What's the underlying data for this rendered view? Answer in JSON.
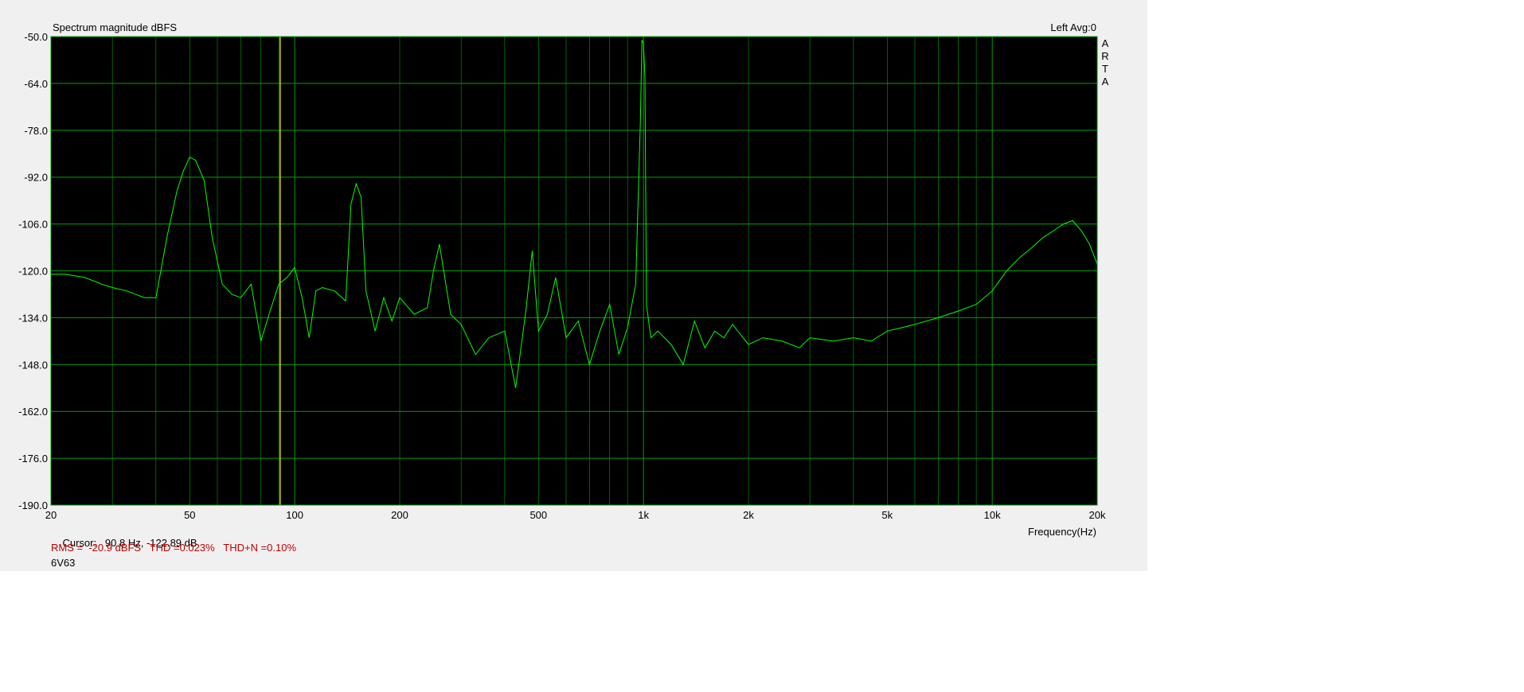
{
  "window": {
    "title_left": "Spectrum magnitude dBFS",
    "title_right": "Left  Avg:0",
    "brand_letters": [
      "A",
      "R",
      "T",
      "A"
    ]
  },
  "cursor": {
    "label": "Cursor:",
    "value": "90.8 Hz, -122.89 dB",
    "frequency_hz": 90.8
  },
  "stats": {
    "text": "RMS =  -20.9 dBFS   THD =0.023%   THD+N =0.10%"
  },
  "device_label": "6V63",
  "colors": {
    "plot_background": "#000000",
    "grid": "#00a000",
    "trace": "#00ff00",
    "cursor_line": "#d2d200",
    "stats_text": "#c00000",
    "panel_background": "#f0f0f0"
  },
  "chart_data": {
    "type": "line",
    "title": "Spectrum magnitude dBFS",
    "xlabel": "Frequency(Hz)",
    "ylabel": "",
    "xscale": "log",
    "xlim": [
      20,
      20000
    ],
    "ylim": [
      -190,
      -50
    ],
    "yticks": [
      -50,
      -64,
      -78,
      -92,
      -106,
      -120,
      -134,
      -148,
      -162,
      -176,
      -190
    ],
    "ytick_labels": [
      "-50.0",
      "-64.0",
      "-78.0",
      "-92.0",
      "-106.0",
      "-120.0",
      "-134.0",
      "-148.0",
      "-162.0",
      "-176.0",
      "-190.0"
    ],
    "xticks": [
      20,
      50,
      100,
      200,
      500,
      1000,
      2000,
      5000,
      10000,
      20000
    ],
    "xtick_labels": [
      "20",
      "50",
      "100",
      "200",
      "500",
      "1k",
      "2k",
      "5k",
      "10k",
      "20k"
    ],
    "grid": true,
    "series": [
      {
        "x": [
          20,
          22,
          25,
          28,
          30,
          33,
          37,
          40,
          43,
          46,
          48,
          50,
          52,
          55,
          58,
          62,
          66,
          70,
          75,
          80,
          85,
          90,
          95,
          100,
          105,
          110,
          115,
          120,
          130,
          140,
          145,
          150,
          155,
          160,
          170,
          180,
          190,
          200,
          220,
          240,
          250,
          260,
          280,
          300,
          330,
          360,
          400,
          430,
          460,
          480,
          500,
          530,
          560,
          600,
          650,
          700,
          750,
          800,
          850,
          900,
          950,
          980,
          990,
          1000,
          1010,
          1020,
          1050,
          1100,
          1200,
          1300,
          1400,
          1500,
          1600,
          1700,
          1800,
          2000,
          2200,
          2500,
          2800,
          3000,
          3500,
          4000,
          4500,
          5000,
          5500,
          6000,
          7000,
          8000,
          9000,
          10000,
          11000,
          12000,
          13000,
          14000,
          15000,
          16000,
          17000,
          18000,
          19000,
          20000
        ],
        "y": [
          -121,
          -121,
          -122,
          -124,
          -125,
          -126,
          -128,
          -128,
          -110,
          -96,
          -90,
          -86,
          -87,
          -93,
          -110,
          -124,
          -127,
          -128,
          -124,
          -141,
          -132,
          -124,
          -122,
          -119,
          -128,
          -140,
          -126,
          -125,
          -126,
          -129,
          -100,
          -94,
          -98,
          -126,
          -138,
          -128,
          -135,
          -128,
          -133,
          -131,
          -120,
          -112,
          -133,
          -136,
          -145,
          -140,
          -138,
          -155,
          -132,
          -114,
          -138,
          -133,
          -122,
          -140,
          -135,
          -148,
          -138,
          -130,
          -145,
          -137,
          -124,
          -75,
          -51,
          -52,
          -62,
          -130,
          -140,
          -138,
          -142,
          -148,
          -135,
          -143,
          -138,
          -140,
          -136,
          -142,
          -140,
          -141,
          -143,
          -140,
          -141,
          -140,
          -141,
          -138,
          -137,
          -136,
          -134,
          -132,
          -130,
          -126,
          -120,
          -116,
          -113,
          -110,
          -108,
          -106,
          -105,
          -108,
          -112,
          -118
        ]
      }
    ]
  }
}
